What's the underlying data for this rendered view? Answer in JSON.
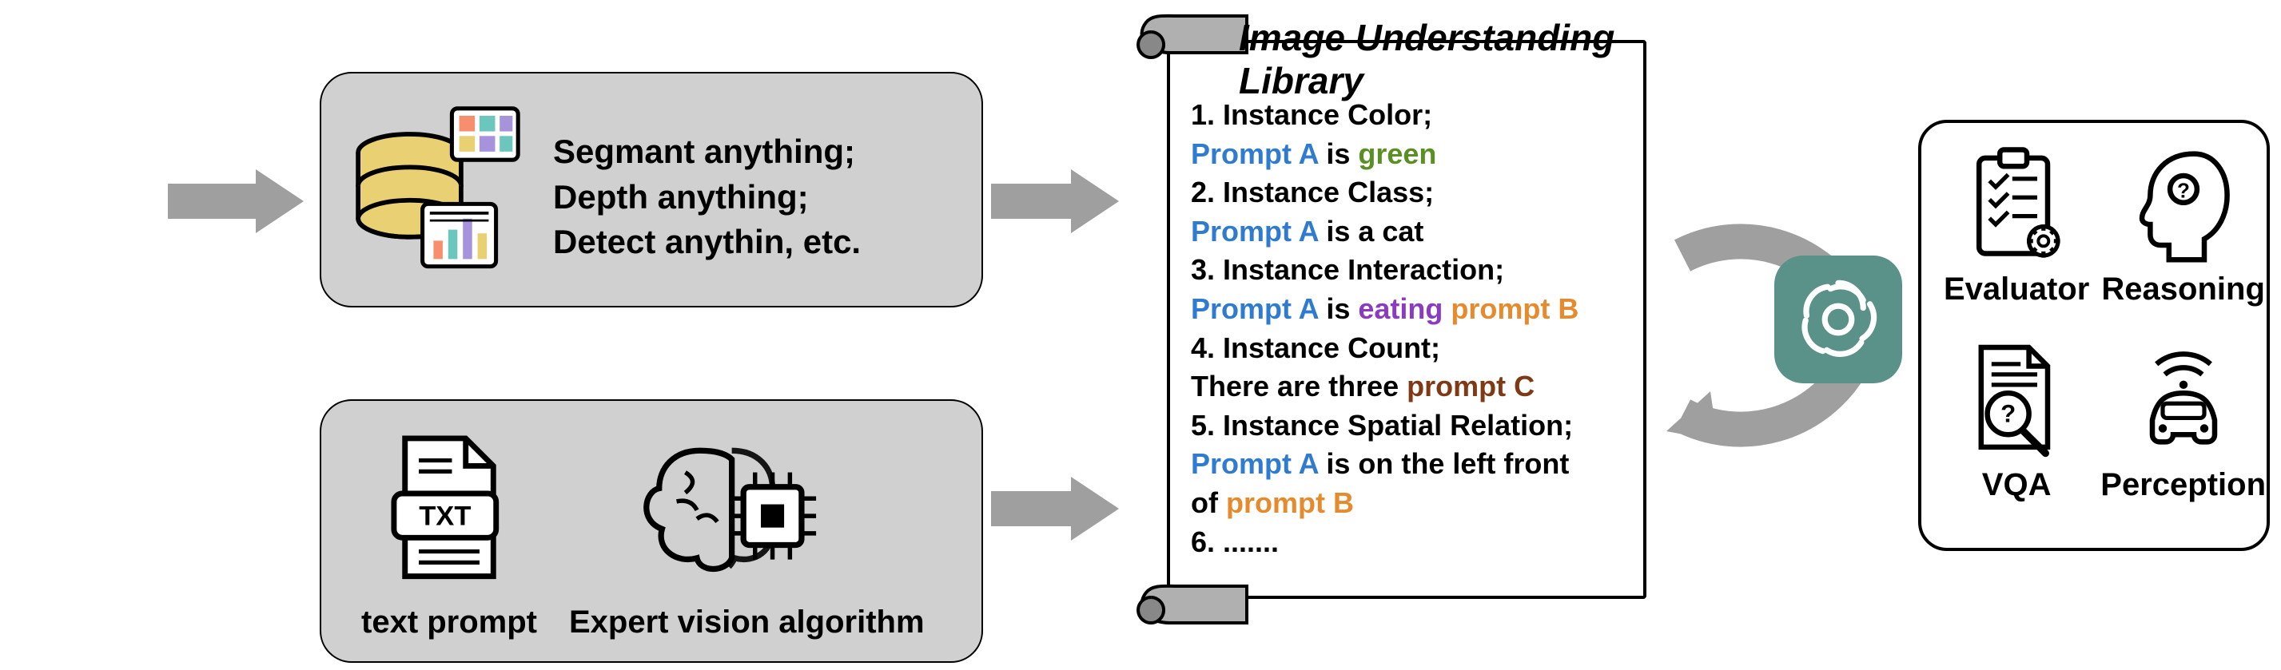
{
  "tools_box": {
    "lines": [
      "Segmant anything;",
      "Depth anything;",
      "Detect anythin, etc."
    ]
  },
  "inputs_box": {
    "text_prompt_label": "text prompt",
    "expert_label": "Expert vision algorithm"
  },
  "library": {
    "title": "Image Understanding Library",
    "items": {
      "i1_head": "1. Instance Color;",
      "i1_a": "Prompt A",
      "i1_mid": " is ",
      "i1_val": "green",
      "i2_head": "2. Instance Class;",
      "i2_a": "Prompt A",
      "i2_rest": " is a cat",
      "i3_head": "3. Instance Interaction;",
      "i3_a": "Prompt A",
      "i3_mid": " is ",
      "i3_verb": "eating",
      "i3_sp": " ",
      "i3_b": "prompt B",
      "i4_head": "4. Instance Count;",
      "i4_pre": "There are three ",
      "i4_c": "prompt C",
      "i5_head": "5. Instance Spatial Relation;",
      "i5_a": "Prompt A",
      "i5_mid": " is on the left front",
      "i5_of": "of ",
      "i5_b": "prompt B",
      "i6": "6. ......."
    }
  },
  "tasks": {
    "evaluator": "Evaluator",
    "reasoning": "Reasoning",
    "vqa": "VQA",
    "perception": "Perception"
  },
  "icons": {
    "db": "database-chart-icon",
    "txt": "txt-file-icon",
    "brain": "brain-chip-icon",
    "openai": "openai-icon",
    "checklist": "checklist-gear-icon",
    "head": "thinking-head-icon",
    "docmag": "document-magnifier-icon",
    "car": "car-radar-icon"
  }
}
